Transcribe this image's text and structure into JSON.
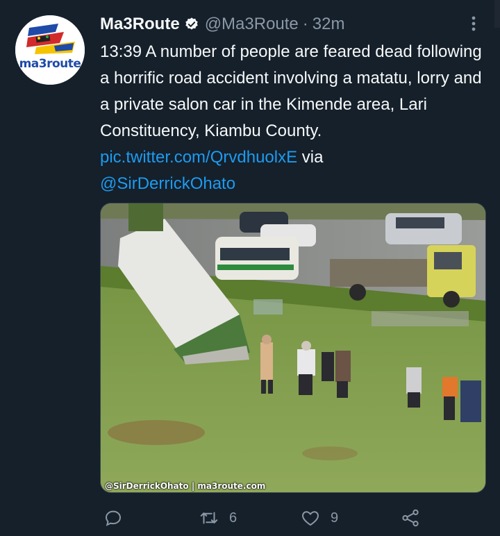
{
  "tweet": {
    "avatar": {
      "icon": "ma3route-logo",
      "brand_text": "ma3route"
    },
    "author": {
      "name": "Ma3Route",
      "verified_icon": "verified-badge-icon",
      "handle": "@Ma3Route",
      "separator": "·",
      "time": "32m"
    },
    "more_icon": "more-options-icon",
    "body": {
      "text": "13:39 A number of people are feared dead following a horrific road accident involving a matatu, lorry and a private salon car in the Kimende area, Lari Constituency, Kiambu County. ",
      "link": "pic.twitter.com/QrvdhuolxE",
      "via": " via",
      "mention": "@SirDerrickOhato"
    },
    "media": {
      "description_icon": "accident-scene-photo",
      "watermark": "@SirDerrickOhato | ma3route.com"
    },
    "actions": {
      "reply_icon": "reply-icon",
      "retweet_icon": "retweet-icon",
      "retweet_count": "6",
      "like_icon": "heart-icon",
      "like_count": "9",
      "share_icon": "share-icon"
    }
  },
  "colors": {
    "background": "#15202b",
    "primary_text": "#f7f9f9",
    "secondary_text": "#8b98a5",
    "link": "#1d9bf0"
  }
}
